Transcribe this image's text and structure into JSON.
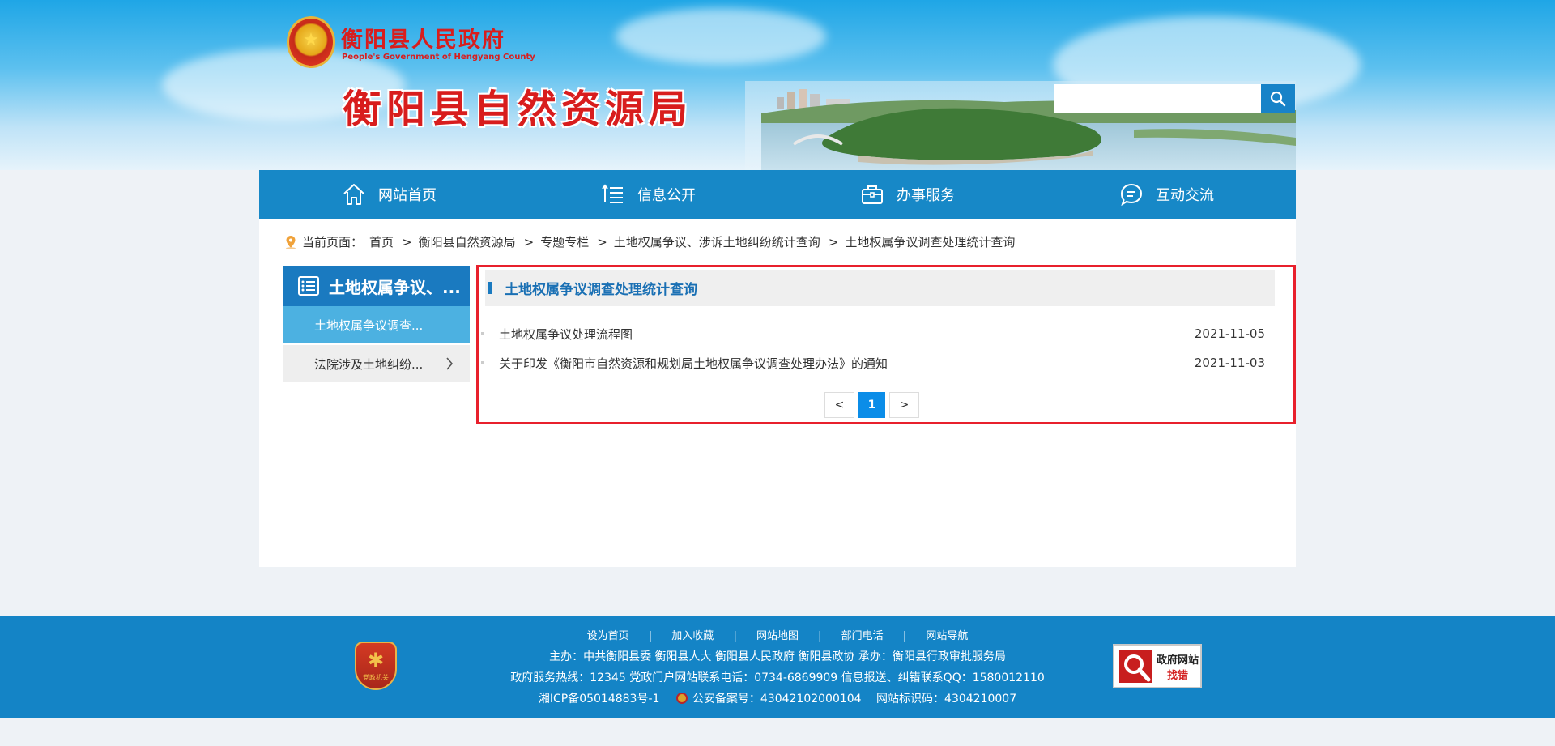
{
  "header": {
    "gov_title": "衡阳县人民政府",
    "gov_subtitle": "People's Government of Hengyang County",
    "bureau_title": "衡阳县自然资源局",
    "search_placeholder": ""
  },
  "nav": {
    "items": [
      {
        "label": "网站首页",
        "icon": "home-icon"
      },
      {
        "label": "信息公开",
        "icon": "list-icon"
      },
      {
        "label": "办事服务",
        "icon": "briefcase-icon"
      },
      {
        "label": "互动交流",
        "icon": "chat-icon"
      }
    ]
  },
  "breadcrumb": {
    "prefix": "当前页面：",
    "items": [
      "首页",
      "衡阳县自然资源局",
      "专题专栏",
      "土地权属争议、涉诉土地纠纷统计查询",
      "土地权属争议调查处理统计查询"
    ],
    "separator": ">"
  },
  "sidebar": {
    "title": "土地权属争议、...",
    "items": [
      {
        "label": "土地权属争议调查...",
        "active": true
      },
      {
        "label": "法院涉及土地纠纷...",
        "active": false
      }
    ]
  },
  "content": {
    "title": "土地权属争议调查处理统计查询",
    "items": [
      {
        "title": "土地权属争议处理流程图",
        "date": "2021-11-05"
      },
      {
        "title": "关于印发《衡阳市自然资源和规划局土地权属争议调查处理办法》的通知",
        "date": "2021-11-03"
      }
    ],
    "pager": {
      "prev": "<",
      "current": "1",
      "next": ">"
    }
  },
  "footer": {
    "links": [
      "设为首页",
      "加入收藏",
      "网站地图",
      "部门电话",
      "网站导航"
    ],
    "line1": "主办：中共衡阳县委 衡阳县人大 衡阳县人民政府 衡阳县政协 承办：衡阳县行政审批服务局",
    "line2": "政府服务热线：12345 党政门户网站联系电话：0734-6869909 信息报送、纠错联系QQ：1580012110",
    "icp": "湘ICP备05014883号-1",
    "police": "公安备案号：43042102000104",
    "site_code": "网站标识码：4304210007",
    "badge_text": "党政机关",
    "find_error_line1": "政府网站",
    "find_error_line2": "找错"
  },
  "colors": {
    "brand_blue": "#1788c7",
    "title_red": "#d81d1d",
    "highlight_red": "#e8202c",
    "sidebar_active": "#4cb1e1"
  }
}
